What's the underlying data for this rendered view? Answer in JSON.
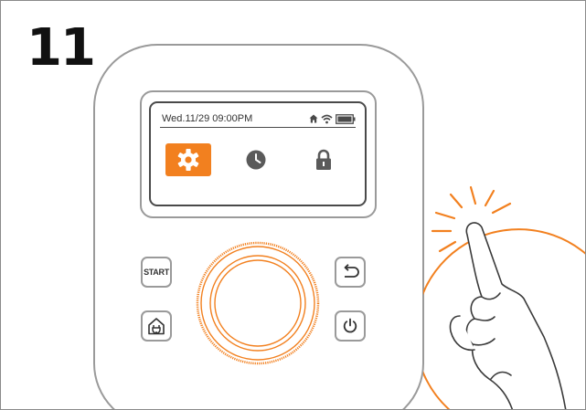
{
  "step": {
    "number": "11"
  },
  "screen": {
    "datetime": "Wed.11/29 09:00PM",
    "status_icons": [
      "home-icon",
      "wifi-icon",
      "battery-icon"
    ],
    "menu": [
      {
        "icon": "gear-icon",
        "selected": true
      },
      {
        "icon": "clock-icon",
        "selected": false
      },
      {
        "icon": "lock-icon",
        "selected": false
      }
    ]
  },
  "buttons": {
    "start_label": "START",
    "home_icon": "house-plug-icon",
    "back_icon": "back-arrow-icon",
    "power_icon": "power-icon"
  },
  "colors": {
    "accent": "#f2801f",
    "outline": "#9a9a9a",
    "screen_border": "#4a4a4a",
    "icon_gray": "#5a5a5a"
  }
}
